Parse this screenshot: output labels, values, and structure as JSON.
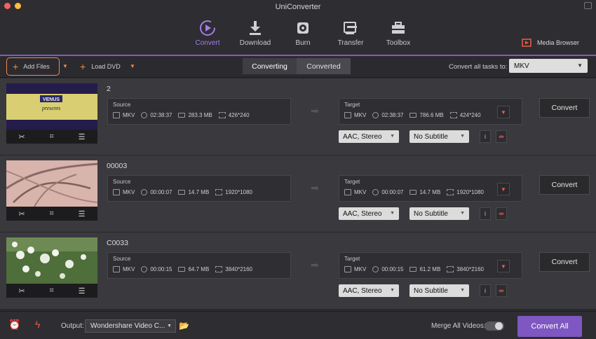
{
  "app": {
    "title": "UniConverter"
  },
  "nav": [
    {
      "label": "Convert",
      "icon": "convert-icon",
      "active": true
    },
    {
      "label": "Download",
      "icon": "download-icon"
    },
    {
      "label": "Burn",
      "icon": "burn-icon"
    },
    {
      "label": "Transfer",
      "icon": "transfer-icon"
    },
    {
      "label": "Toolbox",
      "icon": "toolbox-icon"
    }
  ],
  "media_browser": {
    "label": "Media Browser"
  },
  "toolbar": {
    "add_files": "Add Files",
    "load_dvd": "Load DVD",
    "tab_converting": "Converting",
    "tab_converted": "Converted",
    "convert_all_label": "Convert all tasks to:",
    "format": "MKV"
  },
  "rows": [
    {
      "name": "2",
      "source": {
        "label": "Source",
        "format": "MKV",
        "duration": "02:38:37",
        "size": "283.3 MB",
        "resolution": "426*240"
      },
      "target": {
        "label": "Target",
        "format": "MKV",
        "duration": "02:38:37",
        "size": "786.6 MB",
        "resolution": "424*240"
      },
      "audio": "AAC, Stereo",
      "subtitle": "No Subtitle",
      "convert": "Convert"
    },
    {
      "name": "00003",
      "source": {
        "label": "Source",
        "format": "MKV",
        "duration": "00:00:07",
        "size": "14.7 MB",
        "resolution": "1920*1080"
      },
      "target": {
        "label": "Target",
        "format": "MKV",
        "duration": "00:00:07",
        "size": "14.7 MB",
        "resolution": "1920*1080"
      },
      "audio": "AAC, Stereo",
      "subtitle": "No Subtitle",
      "convert": "Convert"
    },
    {
      "name": "C0033",
      "source": {
        "label": "Source",
        "format": "MKV",
        "duration": "00:00:15",
        "size": "64.7 MB",
        "resolution": "3840*2160"
      },
      "target": {
        "label": "Target",
        "format": "MKV",
        "duration": "00:00:15",
        "size": "61.2 MB",
        "resolution": "3840*2160"
      },
      "audio": "AAC, Stereo",
      "subtitle": "No Subtitle",
      "convert": "Convert"
    }
  ],
  "thumb1_text": {
    "line1": "VENUS",
    "line2": "presents"
  },
  "footer": {
    "output_label": "Output:",
    "output_value": "Wondershare Video C...",
    "merge_label": "Merge All Videos:",
    "merge_on": false,
    "convert_all": "Convert All"
  },
  "colors": {
    "accent": "#7e57c2",
    "highlight": "#f08a4b",
    "red_icon": "#f05a4a"
  }
}
